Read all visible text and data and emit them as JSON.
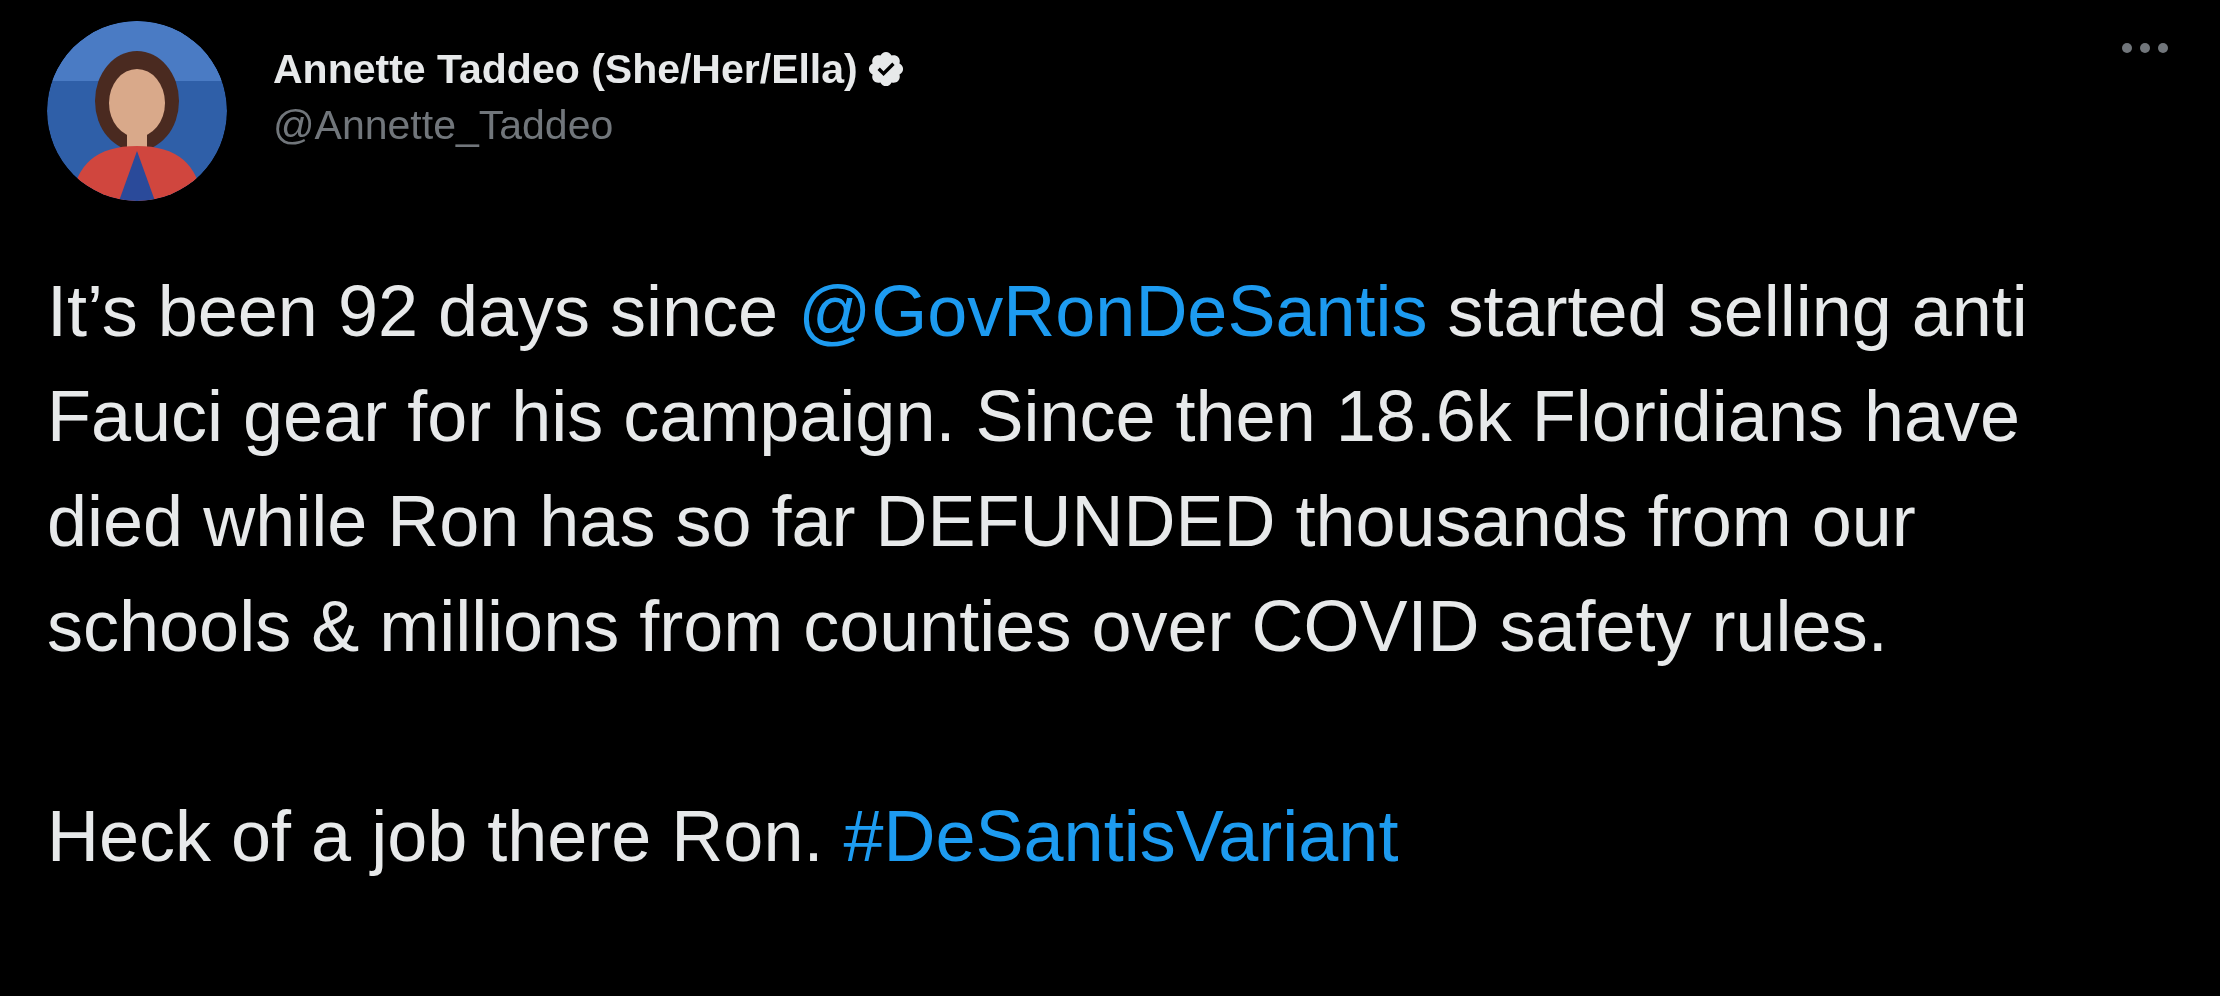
{
  "author": {
    "name": "Annette Taddeo (She/Her/Ella)",
    "verified": true,
    "handle": "@Annette_Taddeo"
  },
  "avatar": {
    "kind": "picture"
  },
  "paragraphs": [
    [
      {
        "kind": "text",
        "text": "It’s been 92 days since "
      },
      {
        "kind": "mention",
        "text": "@GovRonDeSantis"
      },
      {
        "kind": "text",
        "text": " started selling anti Fauci gear for his campaign. Since then 18.6k Floridians have died while Ron has so far DEFUNDED thousands from our schools & millions from counties over COVID safety rules."
      }
    ],
    [
      {
        "kind": "text",
        "text": "Heck of a job there Ron. "
      },
      {
        "kind": "hashtag",
        "text": "#DeSantisVariant"
      }
    ]
  ]
}
